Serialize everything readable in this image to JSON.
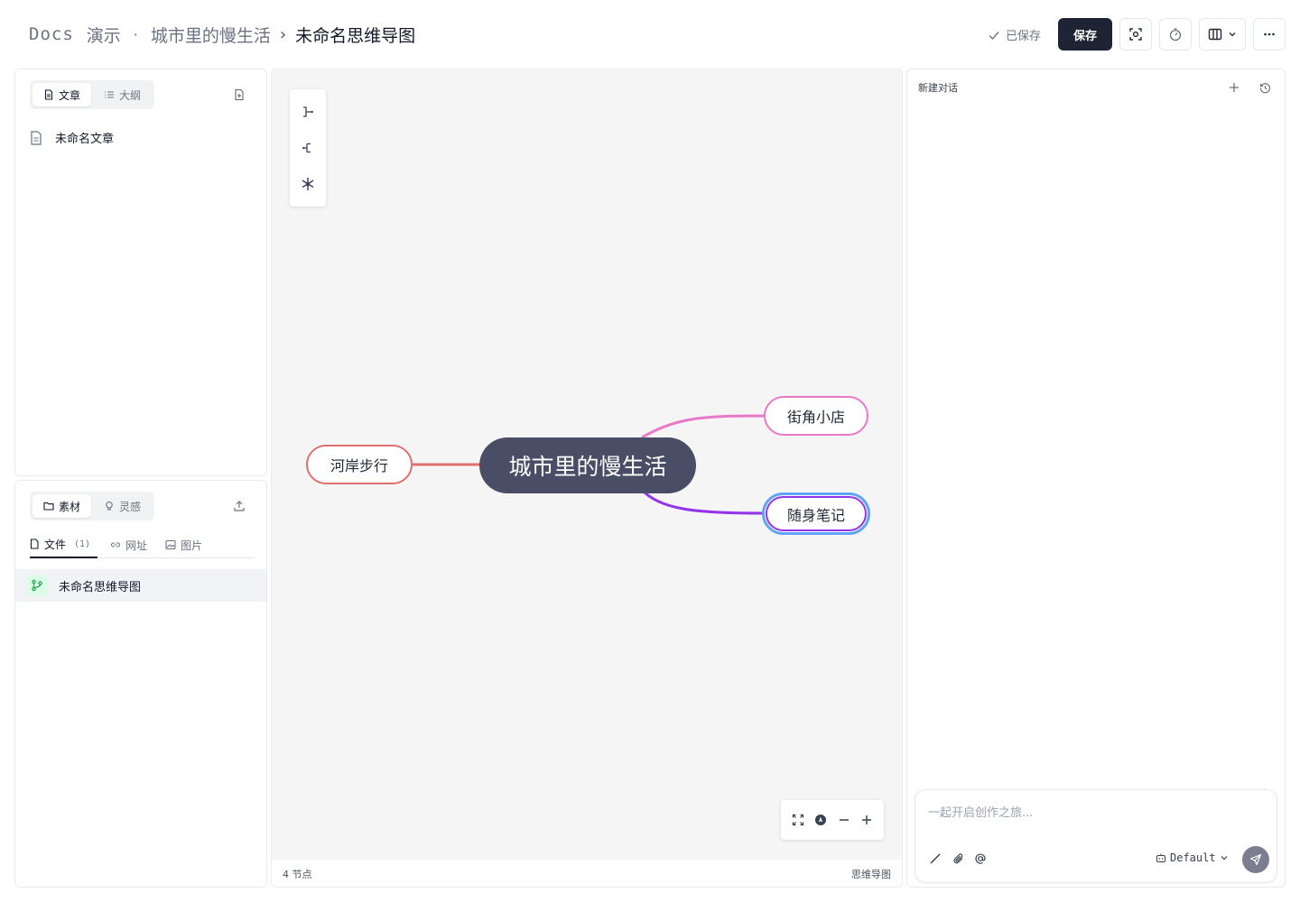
{
  "header": {
    "brand": "Docs",
    "workspace": "演示",
    "separator": "·",
    "project": "城市里的慢生活",
    "chevron": "›",
    "current": "未命名思维导图",
    "saved_status": "已保存",
    "save_label": "保存"
  },
  "left_top": {
    "tabs": [
      "文章",
      "大纲"
    ],
    "active_tab": "文章",
    "documents": [
      "未命名文章"
    ]
  },
  "left_bottom": {
    "tabs": [
      "素材",
      "灵感"
    ],
    "active_tab": "素材",
    "subtabs": [
      {
        "label": "文件",
        "count": "(1)"
      },
      {
        "label": "网址",
        "count": ""
      },
      {
        "label": "图片",
        "count": ""
      }
    ],
    "files": [
      "未命名思维导图"
    ]
  },
  "mindmap": {
    "root": "城市里的慢生活",
    "nodes": [
      {
        "label": "街角小店",
        "color": "#e879c9"
      },
      {
        "label": "随身笔记",
        "color": "#9333ea",
        "selected": true
      },
      {
        "label": "河岸步行",
        "color": "#e07070"
      }
    ],
    "root_color": "#4a4d66",
    "selection_color": "#60a5fa",
    "status_nodes": "4 节点",
    "status_type": "思维导图"
  },
  "chat": {
    "title": "新建对话",
    "placeholder": "一起开启创作之旅...",
    "model": "Default"
  },
  "icons": [
    "file-icon",
    "list-icon",
    "new-doc-icon",
    "folder-icon",
    "bulb-icon",
    "upload-icon",
    "link-icon",
    "image-icon",
    "branch-icon",
    "check-icon",
    "focus-icon",
    "timer-icon",
    "columns-icon",
    "more-icon",
    "fit-icon",
    "locate-icon",
    "minus-icon",
    "plus-icon",
    "history-icon",
    "slash-icon",
    "paperclip-icon",
    "at-icon",
    "bot-icon",
    "send-icon"
  ]
}
